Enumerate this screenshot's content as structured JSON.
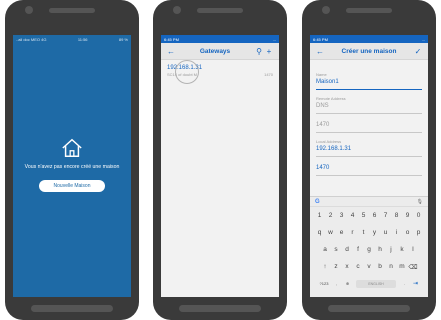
{
  "phone1": {
    "status_left": "..all doc MEO 4G",
    "status_time": "11:56",
    "status_right": "89 %",
    "empty_message": "Vous n'avez pas encore créé une maison",
    "new_button_label": "Nouvelle Maison",
    "background_color": "#1e6aa6"
  },
  "phone2": {
    "status_time": "6:45 PM",
    "status_right": "...",
    "title": "Gateways",
    "back_icon": "arrow-left-icon",
    "search_icon": "search-icon",
    "add_icon": "plus-icon",
    "item": {
      "ip": "192.168.1.31",
      "subtitle": "SC14 of doubt M",
      "port": "1470"
    }
  },
  "phone3": {
    "status_time": "6:45 PM",
    "status_right": "...",
    "title": "Créer une maison",
    "confirm_icon": "check-icon",
    "fields": [
      {
        "label": "Name",
        "value": "Maison1"
      },
      {
        "label": "Remote Address",
        "value": "DNS"
      },
      {
        "label": "",
        "value": "1470"
      },
      {
        "label": "Local Address",
        "value": "192.168.1.31"
      },
      {
        "label": "",
        "value": "1470"
      }
    ],
    "keyboard": {
      "row0": [
        "1",
        "2",
        "3",
        "4",
        "5",
        "6",
        "7",
        "8",
        "9",
        "0"
      ],
      "row1": [
        "q",
        "w",
        "e",
        "r",
        "t",
        "y",
        "u",
        "i",
        "o",
        "p"
      ],
      "row2": [
        "a",
        "s",
        "d",
        "f",
        "g",
        "h",
        "j",
        "k",
        "l"
      ],
      "row3": [
        "↑",
        "z",
        "x",
        "c",
        "v",
        "b",
        "n",
        "m",
        "⌫"
      ],
      "bottom_left": "?123",
      "space_label": "ENGLISH",
      "enter": "⇥"
    }
  }
}
